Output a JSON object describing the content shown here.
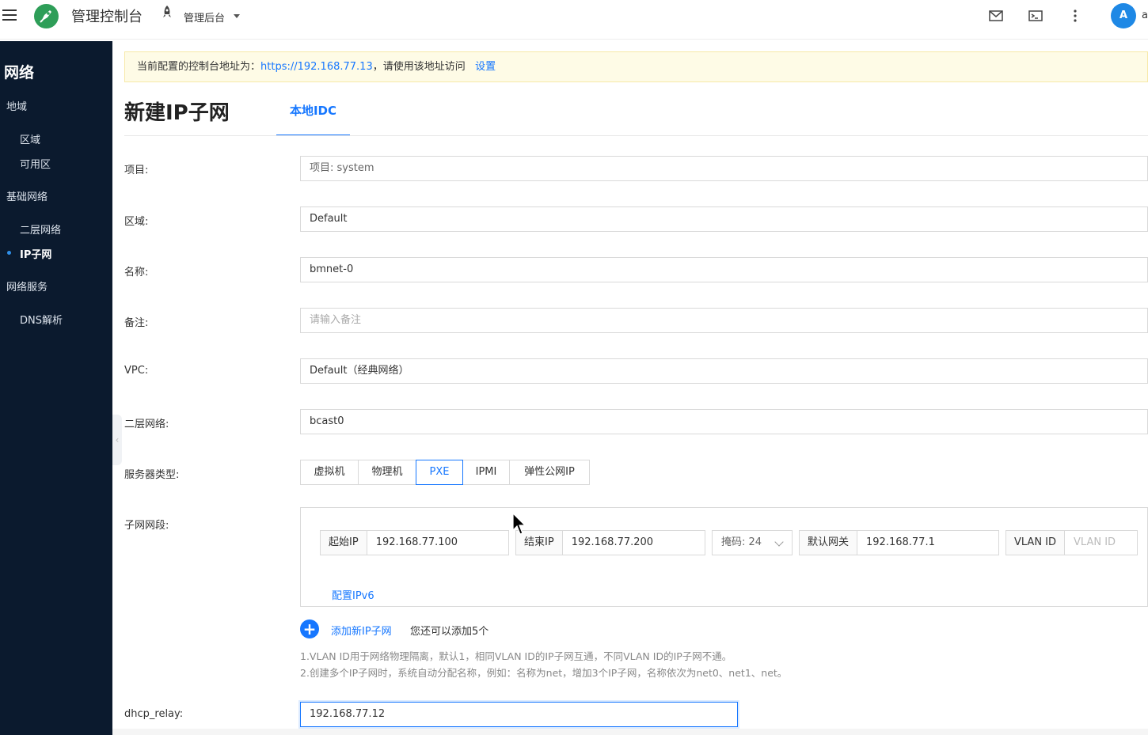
{
  "topbar": {
    "app_title": "管理控制台",
    "project_label": "管理后台",
    "avatar_initial": "A",
    "user_name_fragment": "a"
  },
  "sidebar": {
    "title": "网络",
    "groups": [
      {
        "label": "地域",
        "items": [
          "区域",
          "可用区"
        ]
      },
      {
        "label": "基础网络",
        "items": [
          "二层网络",
          "IP子网"
        ]
      },
      {
        "label": "网络服务",
        "items": [
          "DNS解析"
        ]
      }
    ],
    "active_item": "IP子网"
  },
  "notice": {
    "prefix": "当前配置的控制台地址为：",
    "url": "https://192.168.77.13",
    "suffix": "，请使用该地址访问",
    "action": "设置"
  },
  "page": {
    "title": "新建IP子网",
    "tab": "本地IDC"
  },
  "form": {
    "project": {
      "label": "项目",
      "value": "项目: system"
    },
    "region": {
      "label": "区域",
      "value": "Default"
    },
    "name": {
      "label": "名称",
      "value": "bmnet-0"
    },
    "remark": {
      "label": "备注",
      "placeholder": "请输入备注"
    },
    "vpc": {
      "label": "VPC",
      "value": "Default（经典网络）"
    },
    "l2_network": {
      "label": "二层网络",
      "value": "bcast0"
    },
    "server_type": {
      "label": "服务器类型",
      "options": [
        "虚拟机",
        "物理机",
        "PXE",
        "IPMI",
        "弹性公网IP"
      ],
      "selected": "PXE"
    },
    "subnet": {
      "label": "子网网段",
      "start_ip_label": "起始IP",
      "start_ip": "192.168.77.100",
      "end_ip_label": "结束IP",
      "end_ip": "192.168.77.200",
      "mask": "掩码: 24",
      "gateway_label": "默认网关",
      "gateway": "192.168.77.1",
      "vlan_label": "VLAN ID",
      "vlan_placeholder": "VLAN ID",
      "ipv6_link": "配置IPv6"
    },
    "add_subnet": {
      "label": "添加新IP子网",
      "hint": "您还可以添加5个"
    },
    "tips": [
      "1.VLAN ID用于网络物理隔离，默认1，相同VLAN ID的IP子网互通，不同VLAN ID的IP子网不通。",
      "2.创建多个IP子网时，系统自动分配名称，例如：名称为net，增加3个IP子网，名称依次为net0、net1、net。"
    ],
    "dhcp_relay": {
      "label": "dhcp_relay",
      "value": "192.168.77.12"
    }
  },
  "colors": {
    "primary": "#1677ff",
    "sidebar_bg": "#0b1a2e",
    "notice_bg": "#fefbe6",
    "logo": "#2e9e58"
  }
}
